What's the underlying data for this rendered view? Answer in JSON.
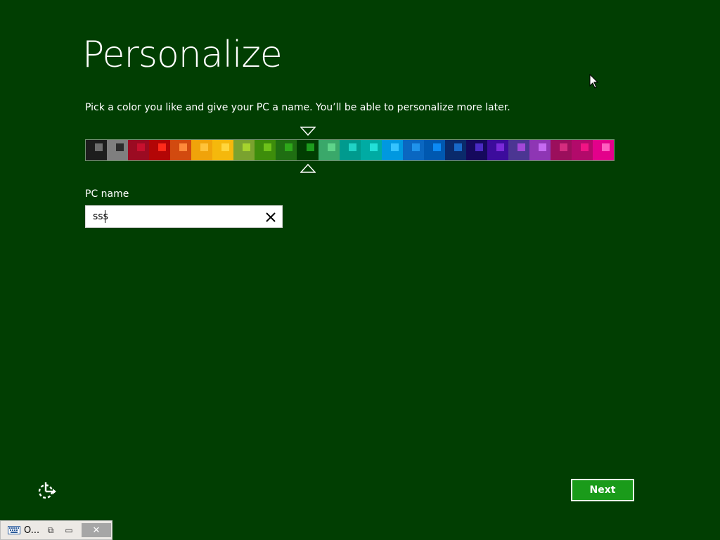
{
  "page": {
    "title": "Personalize",
    "subtitle": "Pick a color you like and give your PC a name. You’ll be able to personalize more later."
  },
  "color_picker": {
    "selected_index": 10,
    "swatches": [
      {
        "bg": "#1d1d1d",
        "chip": "#6e6e6e"
      },
      {
        "bg": "#7f7f7f",
        "chip": "#2b2b2b"
      },
      {
        "bg": "#9b0b22",
        "chip": "#c8102e"
      },
      {
        "bg": "#b30606",
        "chip": "#ff2a1a"
      },
      {
        "bg": "#d24a0f",
        "chip": "#ff8a3a"
      },
      {
        "bg": "#f0a30a",
        "chip": "#ffc33a"
      },
      {
        "bg": "#f5b80c",
        "chip": "#ffd63d"
      },
      {
        "bg": "#7aa22f",
        "chip": "#a6d32e"
      },
      {
        "bg": "#3d8d0b",
        "chip": "#6ec21a"
      },
      {
        "bg": "#1f6e12",
        "chip": "#2ea81a"
      },
      {
        "bg": "#013e02",
        "chip": "#1d9c1d"
      },
      {
        "bg": "#3aa86a",
        "chip": "#5fd48a"
      },
      {
        "bg": "#009a8e",
        "chip": "#20d3c6"
      },
      {
        "bg": "#00aba3",
        "chip": "#22e0d8"
      },
      {
        "bg": "#0098e0",
        "chip": "#34c3ff"
      },
      {
        "bg": "#0a67c1",
        "chip": "#1f93ec"
      },
      {
        "bg": "#0058b0",
        "chip": "#0c8af5"
      },
      {
        "bg": "#0a2a6a",
        "chip": "#1869c8"
      },
      {
        "bg": "#15095c",
        "chip": "#4a2ac4"
      },
      {
        "bg": "#3c0c9c",
        "chip": "#7b2ad9"
      },
      {
        "bg": "#4b3692",
        "chip": "#a248d7"
      },
      {
        "bg": "#8e36b4",
        "chip": "#c66af2"
      },
      {
        "bg": "#9b0f5c",
        "chip": "#d52c7e"
      },
      {
        "bg": "#b20a6a",
        "chip": "#f01484"
      },
      {
        "bg": "#e3018b",
        "chip": "#ff5ec0"
      }
    ]
  },
  "pc_name": {
    "label": "PC name",
    "value": "sss"
  },
  "footer": {
    "next_label": "Next",
    "ease_of_access_icon": "ease-of-access-icon"
  },
  "taskbar": {
    "label": "O...",
    "keyboard_icon": "keyboard-icon",
    "restore_glyph": "⧉",
    "maximize_glyph": "▭",
    "close_glyph": "✕"
  }
}
